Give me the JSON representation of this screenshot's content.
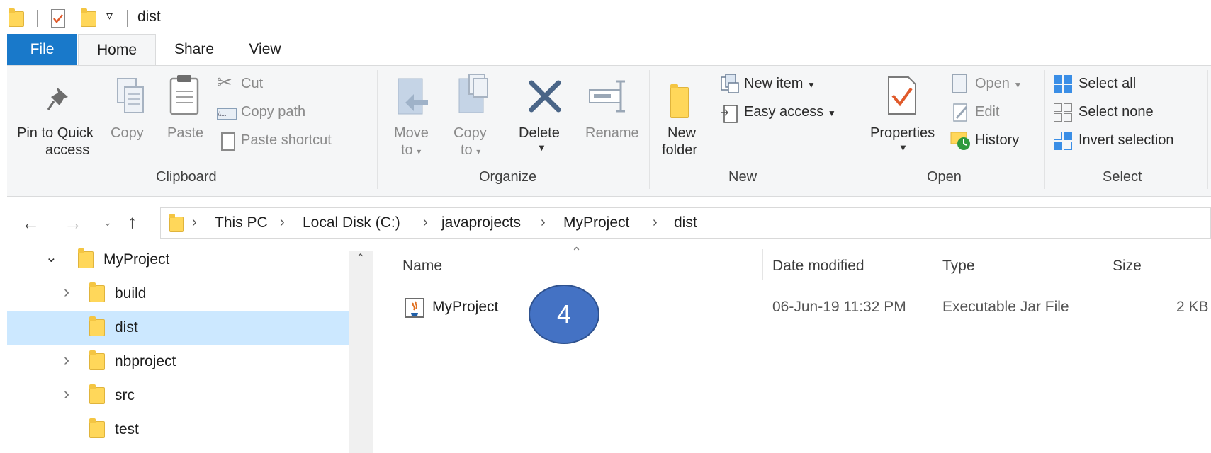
{
  "title_bar": {
    "title": "dist"
  },
  "tabs": {
    "file": "File",
    "home": "Home",
    "share": "Share",
    "view": "View"
  },
  "ribbon": {
    "clipboard": {
      "pin_line1": "Pin to Quick",
      "pin_line2": "access",
      "copy": "Copy",
      "paste": "Paste",
      "cut": "Cut",
      "copy_path": "Copy path",
      "paste_shortcut": "Paste shortcut",
      "group": "Clipboard"
    },
    "organize": {
      "move_line1": "Move",
      "move_line2": "to",
      "copy_line1": "Copy",
      "copy_line2": "to",
      "delete": "Delete",
      "rename": "Rename",
      "group": "Organize"
    },
    "new": {
      "new_folder_line1": "New",
      "new_folder_line2": "folder",
      "new_item": "New item",
      "easy_access": "Easy access",
      "group": "New"
    },
    "open": {
      "properties": "Properties",
      "open": "Open",
      "edit": "Edit",
      "history": "History",
      "group": "Open"
    },
    "select": {
      "select_all": "Select all",
      "select_none": "Select none",
      "invert_selection": "Invert selection",
      "group": "Select"
    }
  },
  "address": {
    "crumbs": [
      "This PC",
      "Local Disk (C:)",
      "javaprojects",
      "MyProject",
      "dist"
    ]
  },
  "nav_tree": {
    "root": "MyProject",
    "children": [
      "build",
      "dist",
      "nbproject",
      "src",
      "test"
    ]
  },
  "file_list": {
    "columns": {
      "name": "Name",
      "date": "Date modified",
      "type": "Type",
      "size": "Size"
    },
    "rows": [
      {
        "name": "MyProject",
        "date": "06-Jun-19 11:32 PM",
        "type": "Executable Jar File",
        "size": "2 KB"
      }
    ]
  },
  "annotation": {
    "step": "4",
    "color": "#4472c4"
  },
  "colors": {
    "accent": "#1979ca",
    "selection": "#cce8ff"
  }
}
